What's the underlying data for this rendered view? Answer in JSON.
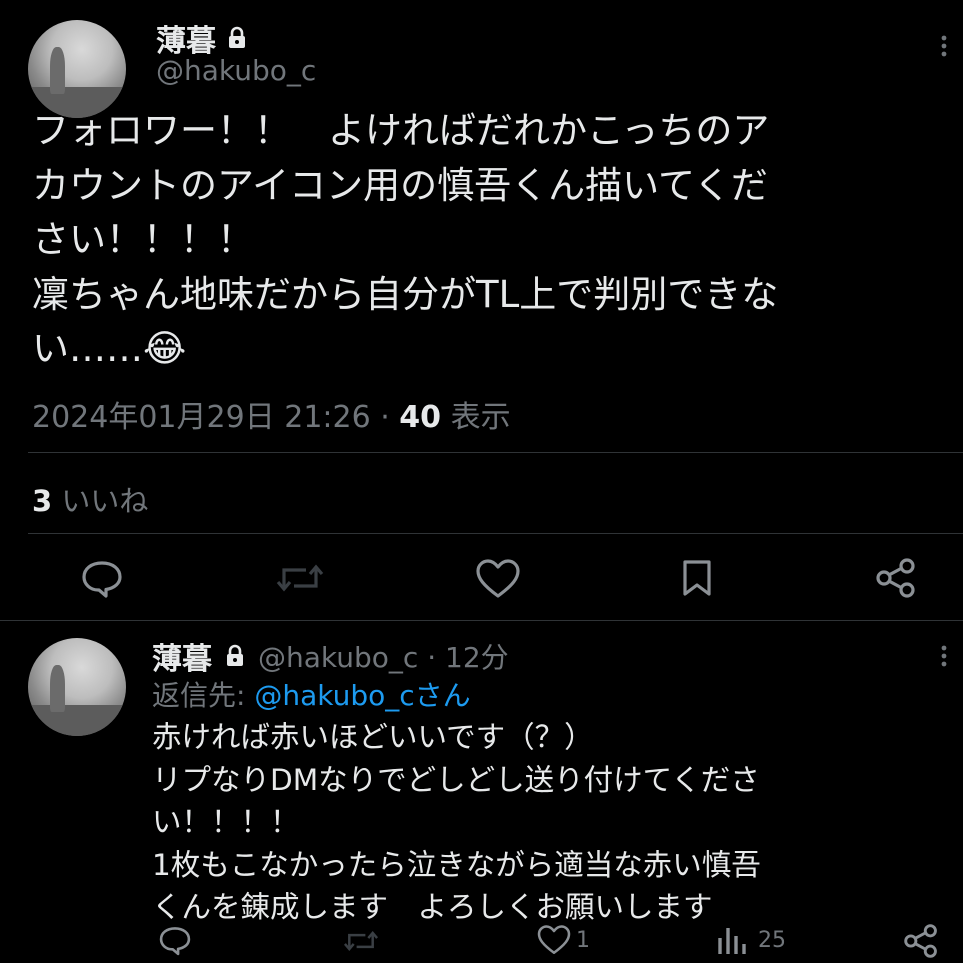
{
  "main_tweet": {
    "display_name": "薄暮",
    "handle": "@hakubo_c",
    "text": "フォロワー！！　よければだれかこっちのア\nカウントのアイコン用の慎吾くん描いてくだ\nさい！！！！\n凜ちゃん地味だから自分がTL上で判別できな\nい……😂",
    "timestamp": "2024年01月29日 21:26",
    "separator": " · ",
    "view_count": "40",
    "view_label": " 表示",
    "like_count": "3",
    "like_label": " いいね"
  },
  "reply_tweet": {
    "display_name": "薄暮",
    "handle_time": "@hakubo_c · 12分",
    "reply_to_prefix": "返信先: ",
    "reply_to_handle": "@hakubo_cさん",
    "text": "赤ければ赤いほどいいです（？）\nリプなりDMなりでどしどし送り付けてくださ\nい！！！！\n1枚もこなかったら泣きながら適当な赤い慎吾\nくんを錬成します　よろしくお願いします",
    "like_count": "1",
    "view_count": "25"
  },
  "icons": {
    "lock": "lock-icon",
    "more": "more-icon",
    "reply": "reply-icon",
    "retweet": "retweet-icon",
    "like": "heart-icon",
    "bookmark": "bookmark-icon",
    "share": "share-icon",
    "views": "analytics-icon"
  },
  "colors": {
    "background": "#000000",
    "text": "#e7e9ea",
    "muted": "#71767b",
    "link": "#1d9bf0",
    "divider": "#2f3336"
  }
}
